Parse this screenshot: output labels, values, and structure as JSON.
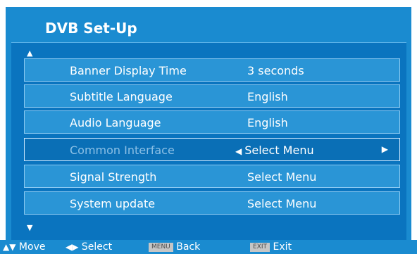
{
  "header": {
    "title": "DVB Set-Up"
  },
  "nav": {
    "up_arrow": "▲",
    "down_arrow": "▼"
  },
  "menu": {
    "items": [
      {
        "label": "Banner Display Time",
        "value": "3 seconds"
      },
      {
        "label": "Subtitle Language",
        "value": "English"
      },
      {
        "label": "Audio Language",
        "value": "English"
      },
      {
        "label": "Common Interface",
        "value": "Select Menu",
        "selected": true,
        "left_arrow": "◀",
        "right_arrow": "▶"
      },
      {
        "label": "Signal Strength",
        "value": "Select Menu"
      },
      {
        "label": "System update",
        "value": "Select Menu"
      }
    ]
  },
  "footer": {
    "move_icon": "▲▼",
    "move_label": "Move",
    "select_icon": "◀▶",
    "select_label": "Select",
    "menu_key": "MENU",
    "back_label": "Back",
    "exit_key": "EXIT",
    "exit_label": "Exit"
  },
  "colors": {
    "background": "#1a8bd0",
    "panel": "#0a74bf",
    "row": "#2a95d6",
    "row_border": "#8ccaf2",
    "selected_label": "#8cc0e6",
    "key_bg": "#c6c6c6"
  }
}
